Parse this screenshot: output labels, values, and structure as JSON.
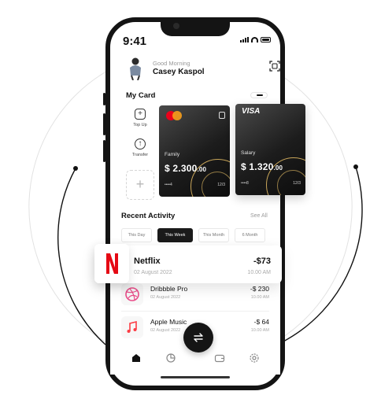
{
  "status": {
    "time": "9:41"
  },
  "user": {
    "greeting": "Good Morning",
    "name": "Casey Kaspol"
  },
  "my_card": {
    "title": "My Card",
    "actions": [
      {
        "label": "Top Up",
        "icon": "plus-icon"
      },
      {
        "label": "Transfer",
        "icon": "arrow-up-icon"
      }
    ],
    "add_label": "+",
    "cards": [
      {
        "brand": "mastercard",
        "name": "Family",
        "amount_main": "$ 2.300",
        "amount_cents": ".00",
        "number": "••••4",
        "expiry": "12/3"
      },
      {
        "brand": "VISA",
        "name": "Salary",
        "amount_main": "$ 1.320",
        "amount_cents": ".00",
        "number": "••••8",
        "expiry": "12/3"
      }
    ]
  },
  "recent": {
    "title": "Recent Activity",
    "see_all": "See All",
    "filters": [
      "This Day",
      "This Week",
      "This Month",
      "6 Month"
    ],
    "active_filter": "This Week",
    "transactions": [
      {
        "name": "Netflix",
        "date": "02 August 2022",
        "amount": "-$73",
        "time": "10.00 AM",
        "icon": "netflix-logo-icon"
      },
      {
        "name": "Dribbble Pro",
        "date": "02 August 2022",
        "amount": "-$ 230",
        "time": "10.00 AM",
        "icon": "dribbble-icon"
      },
      {
        "name": "Apple Music",
        "date": "02 August 2022",
        "amount": "-$ 64",
        "time": "10.00 AM",
        "icon": "music-note-icon"
      }
    ]
  },
  "tabbar": {
    "tabs": [
      "home-icon",
      "pie-chart-icon",
      "wallet-icon",
      "settings-icon"
    ],
    "fab_icon": "transfer-arrows-icon"
  },
  "colors": {
    "accent_gold": "#c9a65a",
    "dribbble_pink": "#ea4c89",
    "netflix_red": "#e50914",
    "music_pink": "#fc3c44"
  }
}
